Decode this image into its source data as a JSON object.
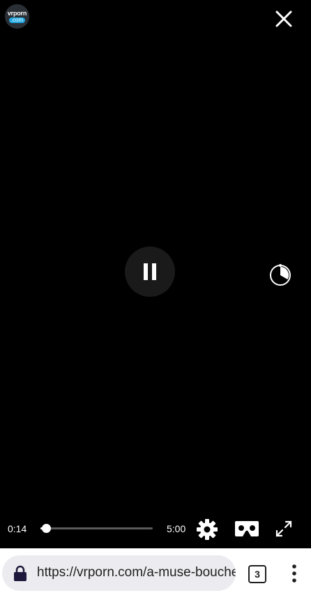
{
  "player": {
    "logo": {
      "top": "vrporn",
      "bottom": ".com"
    },
    "time_current": "0:14",
    "time_total": "5:00",
    "progress_fraction": 0.0467
  },
  "browser": {
    "url": "https://vrporn.com/a-muse-bouche",
    "tab_count": "3"
  },
  "icons": {
    "close": "close-icon",
    "pause": "pause-icon",
    "compass": "compass-icon",
    "settings": "gear-icon",
    "vr": "vr-headset-icon",
    "fullscreen": "fullscreen-icon",
    "lock": "lock-icon",
    "menu": "kebab-menu-icon"
  },
  "colors": {
    "background": "#000000",
    "logo_accent": "#1ea7e1",
    "url_pill": "#ececf0"
  }
}
